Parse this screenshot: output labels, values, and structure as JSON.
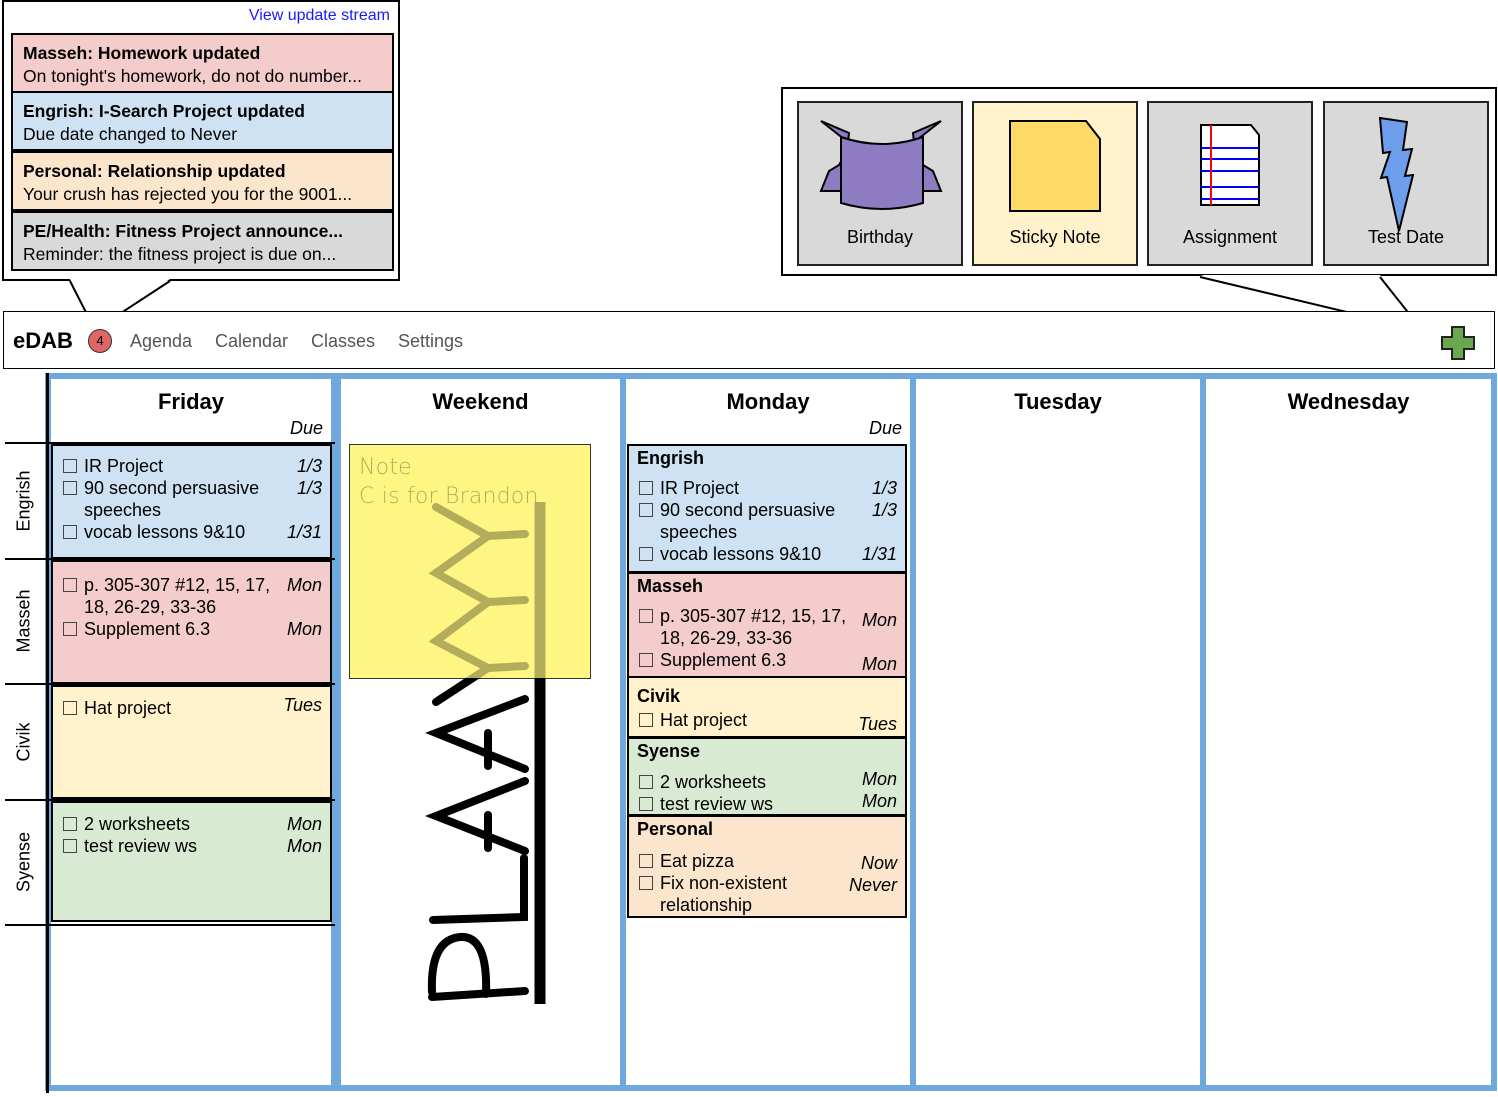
{
  "update_stream": {
    "link": "View update stream",
    "items": [
      {
        "title": "Masseh: Homework updated",
        "body": "On tonight's homework, do not do number...",
        "color": "#f4cccc"
      },
      {
        "title": "Engrish: I-Search Project updated",
        "body": "Due date changed to Never",
        "color": "#cfe2f3"
      },
      {
        "title": "Personal: Relationship updated",
        "body": "Your crush has rejected you for the 9001...",
        "color": "#fce5cd"
      },
      {
        "title": "PE/Health: Fitness Project announce...",
        "body": "Reminder: the fitness project is due on...",
        "color": "#d9d9d9"
      }
    ]
  },
  "add_menu": {
    "items": [
      {
        "label": "Birthday",
        "icon": "banner-icon",
        "selected": false
      },
      {
        "label": "Sticky Note",
        "icon": "sticky-note-icon",
        "selected": true
      },
      {
        "label": "Assignment",
        "icon": "lined-paper-icon",
        "selected": false
      },
      {
        "label": "Test Date",
        "icon": "lightning-icon",
        "selected": false
      }
    ]
  },
  "navbar": {
    "brand": "eDAB",
    "notification_count": "4",
    "links": [
      "Agenda",
      "Calendar",
      "Classes",
      "Settings"
    ],
    "add_icon": "plus-icon"
  },
  "row_labels": [
    "Engrish",
    "Masseh",
    "Civik",
    "Syense"
  ],
  "days": {
    "friday": {
      "title": "Friday",
      "due_label": "Due",
      "classes": [
        {
          "name": "Engrish",
          "tasks": [
            {
              "name": "IR Project",
              "due": "1/3"
            },
            {
              "name": "90 second persuasive speeches",
              "due": "1/3"
            },
            {
              "name": "vocab lessons 9&10",
              "due": "1/31"
            }
          ]
        },
        {
          "name": "Masseh",
          "tasks": [
            {
              "name": "p. 305-307 #12, 15, 17, 18, 26-29, 33-36",
              "due": "Mon"
            },
            {
              "name": "Supplement 6.3",
              "due": "Mon"
            }
          ]
        },
        {
          "name": "Civik",
          "tasks": [
            {
              "name": "Hat project",
              "due": "Tues"
            }
          ]
        },
        {
          "name": "Syense",
          "tasks": [
            {
              "name": "2 worksheets",
              "due": "Mon"
            },
            {
              "name": "test review ws",
              "due": "Mon"
            }
          ]
        }
      ]
    },
    "weekend": {
      "title": "Weekend",
      "sticky_note": {
        "line1": "Note",
        "line2": "C is for Brandon"
      },
      "handwriting": "PLAAY"
    },
    "monday": {
      "title": "Monday",
      "due_label": "Due",
      "classes": [
        {
          "name": "Engrish",
          "tasks": [
            {
              "name": "IR Project",
              "due": "1/3"
            },
            {
              "name": "90 second persuasive speeches",
              "due": "1/3"
            },
            {
              "name": "vocab lessons 9&10",
              "due": "1/31"
            }
          ]
        },
        {
          "name": "Masseh",
          "tasks": [
            {
              "name": "p. 305-307 #12, 15, 17, 18, 26-29, 33-36",
              "due": "Mon"
            },
            {
              "name": "Supplement 6.3",
              "due": "Mon"
            }
          ]
        },
        {
          "name": "Civik",
          "tasks": [
            {
              "name": "Hat project",
              "due": "Tues"
            }
          ]
        },
        {
          "name": "Syense",
          "tasks": [
            {
              "name": "2 worksheets",
              "due": "Mon"
            },
            {
              "name": "test review ws",
              "due": "Mon"
            }
          ]
        },
        {
          "name": "Personal",
          "tasks": [
            {
              "name": "Eat pizza",
              "due": "Now"
            },
            {
              "name": "Fix non-existent relationship",
              "due": "Never"
            }
          ]
        }
      ]
    },
    "tuesday": {
      "title": "Tuesday"
    },
    "wednesday": {
      "title": "Wednesday"
    }
  },
  "colors": {
    "day_border": "#6fa8dc",
    "engrish": "#cfe2f3",
    "masseh": "#f4cccc",
    "civik": "#fff2cc",
    "syense": "#d9ead3",
    "personal": "#fce5cd",
    "sticky": "#fff582",
    "add_button": "#6aa84f"
  }
}
